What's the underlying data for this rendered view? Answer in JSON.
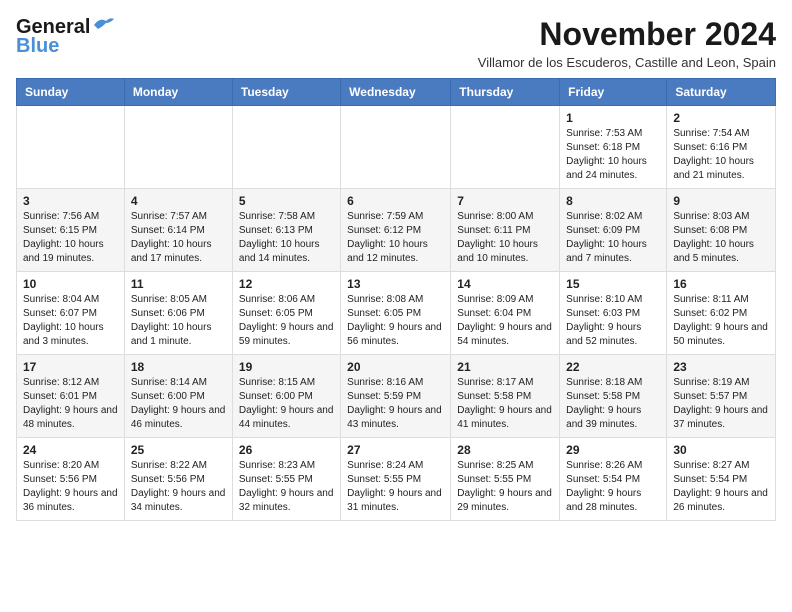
{
  "header": {
    "logo_line1": "General",
    "logo_line2": "Blue",
    "title": "November 2024",
    "location": "Villamor de los Escuderos, Castille and Leon, Spain"
  },
  "weekdays": [
    "Sunday",
    "Monday",
    "Tuesday",
    "Wednesday",
    "Thursday",
    "Friday",
    "Saturday"
  ],
  "weeks": [
    [
      {
        "day": "",
        "info": ""
      },
      {
        "day": "",
        "info": ""
      },
      {
        "day": "",
        "info": ""
      },
      {
        "day": "",
        "info": ""
      },
      {
        "day": "",
        "info": ""
      },
      {
        "day": "1",
        "info": "Sunrise: 7:53 AM\nSunset: 6:18 PM\nDaylight: 10 hours and 24 minutes."
      },
      {
        "day": "2",
        "info": "Sunrise: 7:54 AM\nSunset: 6:16 PM\nDaylight: 10 hours and 21 minutes."
      }
    ],
    [
      {
        "day": "3",
        "info": "Sunrise: 7:56 AM\nSunset: 6:15 PM\nDaylight: 10 hours and 19 minutes."
      },
      {
        "day": "4",
        "info": "Sunrise: 7:57 AM\nSunset: 6:14 PM\nDaylight: 10 hours and 17 minutes."
      },
      {
        "day": "5",
        "info": "Sunrise: 7:58 AM\nSunset: 6:13 PM\nDaylight: 10 hours and 14 minutes."
      },
      {
        "day": "6",
        "info": "Sunrise: 7:59 AM\nSunset: 6:12 PM\nDaylight: 10 hours and 12 minutes."
      },
      {
        "day": "7",
        "info": "Sunrise: 8:00 AM\nSunset: 6:11 PM\nDaylight: 10 hours and 10 minutes."
      },
      {
        "day": "8",
        "info": "Sunrise: 8:02 AM\nSunset: 6:09 PM\nDaylight: 10 hours and 7 minutes."
      },
      {
        "day": "9",
        "info": "Sunrise: 8:03 AM\nSunset: 6:08 PM\nDaylight: 10 hours and 5 minutes."
      }
    ],
    [
      {
        "day": "10",
        "info": "Sunrise: 8:04 AM\nSunset: 6:07 PM\nDaylight: 10 hours and 3 minutes."
      },
      {
        "day": "11",
        "info": "Sunrise: 8:05 AM\nSunset: 6:06 PM\nDaylight: 10 hours and 1 minute."
      },
      {
        "day": "12",
        "info": "Sunrise: 8:06 AM\nSunset: 6:05 PM\nDaylight: 9 hours and 59 minutes."
      },
      {
        "day": "13",
        "info": "Sunrise: 8:08 AM\nSunset: 6:05 PM\nDaylight: 9 hours and 56 minutes."
      },
      {
        "day": "14",
        "info": "Sunrise: 8:09 AM\nSunset: 6:04 PM\nDaylight: 9 hours and 54 minutes."
      },
      {
        "day": "15",
        "info": "Sunrise: 8:10 AM\nSunset: 6:03 PM\nDaylight: 9 hours and 52 minutes."
      },
      {
        "day": "16",
        "info": "Sunrise: 8:11 AM\nSunset: 6:02 PM\nDaylight: 9 hours and 50 minutes."
      }
    ],
    [
      {
        "day": "17",
        "info": "Sunrise: 8:12 AM\nSunset: 6:01 PM\nDaylight: 9 hours and 48 minutes."
      },
      {
        "day": "18",
        "info": "Sunrise: 8:14 AM\nSunset: 6:00 PM\nDaylight: 9 hours and 46 minutes."
      },
      {
        "day": "19",
        "info": "Sunrise: 8:15 AM\nSunset: 6:00 PM\nDaylight: 9 hours and 44 minutes."
      },
      {
        "day": "20",
        "info": "Sunrise: 8:16 AM\nSunset: 5:59 PM\nDaylight: 9 hours and 43 minutes."
      },
      {
        "day": "21",
        "info": "Sunrise: 8:17 AM\nSunset: 5:58 PM\nDaylight: 9 hours and 41 minutes."
      },
      {
        "day": "22",
        "info": "Sunrise: 8:18 AM\nSunset: 5:58 PM\nDaylight: 9 hours and 39 minutes."
      },
      {
        "day": "23",
        "info": "Sunrise: 8:19 AM\nSunset: 5:57 PM\nDaylight: 9 hours and 37 minutes."
      }
    ],
    [
      {
        "day": "24",
        "info": "Sunrise: 8:20 AM\nSunset: 5:56 PM\nDaylight: 9 hours and 36 minutes."
      },
      {
        "day": "25",
        "info": "Sunrise: 8:22 AM\nSunset: 5:56 PM\nDaylight: 9 hours and 34 minutes."
      },
      {
        "day": "26",
        "info": "Sunrise: 8:23 AM\nSunset: 5:55 PM\nDaylight: 9 hours and 32 minutes."
      },
      {
        "day": "27",
        "info": "Sunrise: 8:24 AM\nSunset: 5:55 PM\nDaylight: 9 hours and 31 minutes."
      },
      {
        "day": "28",
        "info": "Sunrise: 8:25 AM\nSunset: 5:55 PM\nDaylight: 9 hours and 29 minutes."
      },
      {
        "day": "29",
        "info": "Sunrise: 8:26 AM\nSunset: 5:54 PM\nDaylight: 9 hours and 28 minutes."
      },
      {
        "day": "30",
        "info": "Sunrise: 8:27 AM\nSunset: 5:54 PM\nDaylight: 9 hours and 26 minutes."
      }
    ]
  ]
}
